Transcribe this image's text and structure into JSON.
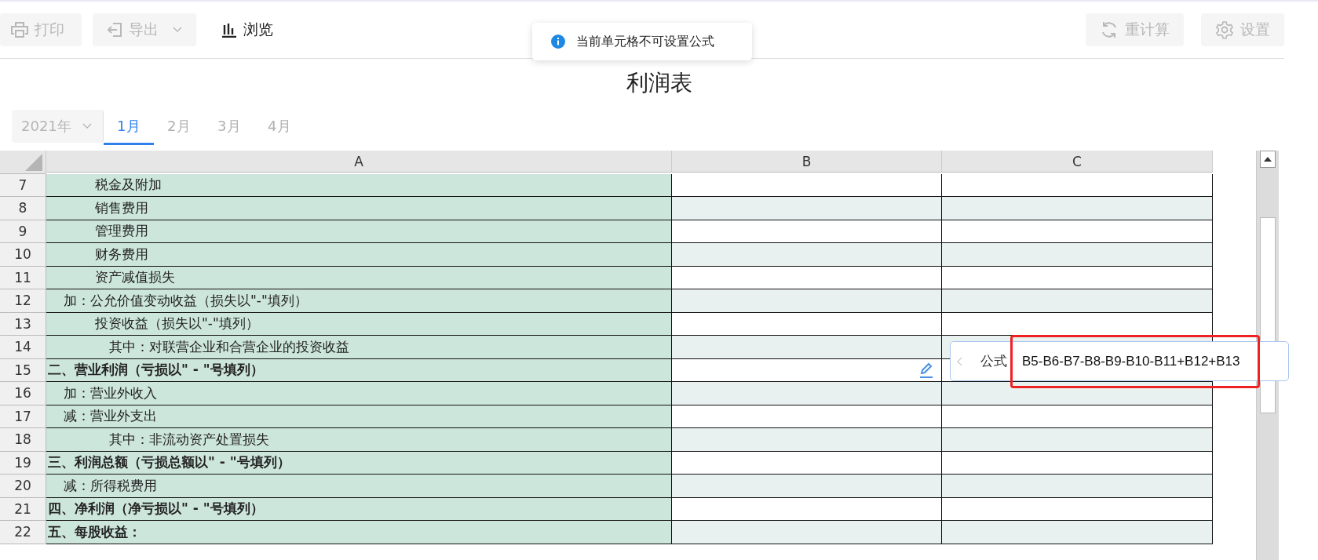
{
  "toolbar": {
    "left": [
      {
        "kind": "print",
        "label": "打印",
        "disabled": true
      },
      {
        "kind": "export",
        "label": "导出",
        "disabled": true
      },
      {
        "kind": "browse",
        "label": "浏览",
        "disabled": false
      }
    ],
    "right": [
      {
        "kind": "recalc",
        "label": "重计算",
        "disabled": true
      },
      {
        "kind": "settings",
        "label": "设置",
        "disabled": true
      }
    ]
  },
  "toast": {
    "message": "当前单元格不可设置公式"
  },
  "title": "利润表",
  "year_select": {
    "value": "2021年"
  },
  "tabs": [
    {
      "label": "1月",
      "selected": true
    },
    {
      "label": "2月",
      "selected": false
    },
    {
      "label": "3月",
      "selected": false
    },
    {
      "label": "4月",
      "selected": false
    }
  ],
  "sheet": {
    "columns": [
      "A",
      "B",
      "C"
    ],
    "rows": [
      {
        "number": "7",
        "kind": "item",
        "text": "税金及附加"
      },
      {
        "number": "8",
        "kind": "item",
        "text": "销售费用"
      },
      {
        "number": "9",
        "kind": "item",
        "text": "管理费用"
      },
      {
        "number": "10",
        "kind": "item",
        "text": "财务费用"
      },
      {
        "number": "11",
        "kind": "item",
        "text": "资产减值损失"
      },
      {
        "number": "12",
        "kind": "prefix",
        "text": "加：公允价值变动收益（损失以\"-\"填列）"
      },
      {
        "number": "13",
        "kind": "item",
        "text": "投资收益（损失以\"-\"填列）"
      },
      {
        "number": "14",
        "kind": "detail",
        "text": "其中：对联营企业和合营企业的投资收益"
      },
      {
        "number": "15",
        "kind": "heading",
        "text": "二、营业利润（亏损以\" - \"号填列）"
      },
      {
        "number": "16",
        "kind": "prefix",
        "text": "加：营业外收入"
      },
      {
        "number": "17",
        "kind": "prefix",
        "text": "减：营业外支出"
      },
      {
        "number": "18",
        "kind": "detail",
        "text": "其中：非流动资产处置损失"
      },
      {
        "number": "19",
        "kind": "heading",
        "text": "三、利润总额（亏损总额以\" - \"号填列）"
      },
      {
        "number": "20",
        "kind": "prefix",
        "text": "减：所得税费用"
      },
      {
        "number": "21",
        "kind": "heading",
        "text": "四、净利润（净亏损以\" - \"号填列）"
      },
      {
        "number": "22",
        "kind": "heading",
        "text": "五、每股收益："
      }
    ]
  },
  "formula_popup": {
    "label": "公式",
    "value": "B5-B6-B7-B8-B9-B10-B11+B12+B13"
  }
}
